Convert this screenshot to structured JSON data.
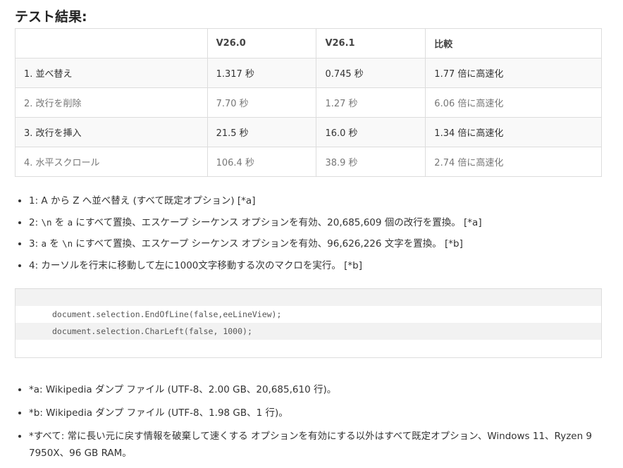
{
  "heading": "テスト結果:",
  "table": {
    "headers": [
      "",
      "V26.0",
      "V26.1",
      "比較"
    ],
    "rows": [
      [
        "1. 並べ替え",
        "1.317 秒",
        "0.745 秒",
        "1.77 倍に高速化"
      ],
      [
        "2. 改行を削除",
        "7.70 秒",
        "1.27 秒",
        "6.06 倍に高速化"
      ],
      [
        "3. 改行を挿入",
        "21.5 秒",
        "16.0 秒",
        "1.34 倍に高速化"
      ],
      [
        "4. 水平スクロール",
        "106.4 秒",
        "38.9 秒",
        "2.74 倍に高速化"
      ]
    ]
  },
  "notes": [
    {
      "text": "1: A から Z へ並べ替え (すべて既定オプション) [*a]"
    },
    {
      "pre": "2: ",
      "code1": "\\n",
      "mid1": " を ",
      "code2": "a",
      "post": " にすべて置換、エスケープ シーケンス オプションを有効、20,685,609 個の改行を置換。 [*a]"
    },
    {
      "pre": "3: ",
      "code1": "a",
      "mid1": " を ",
      "code2": "\\n",
      "post": " にすべて置換、エスケープ シーケンス オプションを有効、96,626,226 文字を置換。 [*b]"
    },
    {
      "text": "4: カーソルを行末に移動して左に1000文字移動する次のマクロを実行。 [*b]"
    }
  ],
  "code": {
    "lines": [
      "document.selection.EndOfLine(false,eeLineView);",
      "document.selection.CharLeft(false, 1000);"
    ]
  },
  "footnotes": [
    "*a: Wikipedia ダンプ ファイル (UTF-8、2.00 GB、20,685,610 行)。",
    "*b: Wikipedia ダンプ ファイル (UTF-8、1.98 GB、1 行)。",
    "*すべて: 常に長い元に戻す情報を破棄して速くする オプションを有効にする以外はすべて既定オプション、Windows 11、Ryzen 9 7950X、96 GB RAM。"
  ]
}
